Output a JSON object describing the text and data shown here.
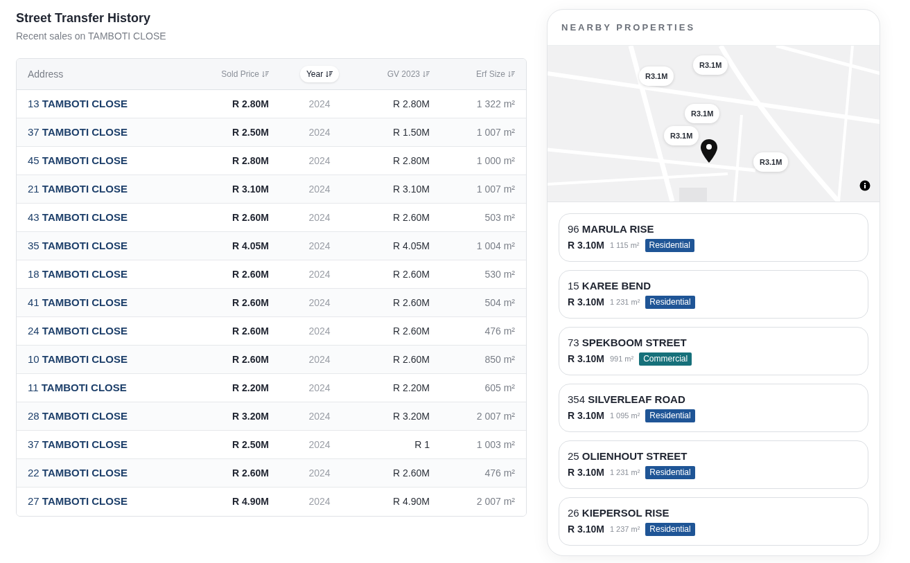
{
  "history": {
    "title": "Street Transfer History",
    "subtitle": "Recent sales on TAMBOTI CLOSE",
    "columns": [
      {
        "label": "Address",
        "sortable": false,
        "selected": false
      },
      {
        "label": "Sold Price",
        "sortable": true,
        "selected": false
      },
      {
        "label": "Year",
        "sortable": true,
        "selected": true
      },
      {
        "label": "GV 2023",
        "sortable": true,
        "selected": false
      },
      {
        "label": "Erf Size",
        "sortable": true,
        "selected": false
      }
    ],
    "rows": [
      {
        "address": "13 **TAMBOTI CLOSE**",
        "sold_price": "R 2.80M",
        "year": "2024",
        "gv_2023": "R 2.80M",
        "erf_size": "1 322 m²"
      },
      {
        "address": "37 **TAMBOTI CLOSE**",
        "sold_price": "R 2.50M",
        "year": "2024",
        "gv_2023": "R 1.50M",
        "erf_size": "1 007 m²"
      },
      {
        "address": "45 **TAMBOTI CLOSE**",
        "sold_price": "R 2.80M",
        "year": "2024",
        "gv_2023": "R 2.80M",
        "erf_size": "1 000 m²"
      },
      {
        "address": "21 **TAMBOTI CLOSE**",
        "sold_price": "R 3.10M",
        "year": "2024",
        "gv_2023": "R 3.10M",
        "erf_size": "1 007 m²"
      },
      {
        "address": "43 **TAMBOTI CLOSE**",
        "sold_price": "R 2.60M",
        "year": "2024",
        "gv_2023": "R 2.60M",
        "erf_size": "503 m²"
      },
      {
        "address": "35 **TAMBOTI CLOSE**",
        "sold_price": "R 4.05M",
        "year": "2024",
        "gv_2023": "R 4.05M",
        "erf_size": "1 004 m²"
      },
      {
        "address": "18 **TAMBOTI CLOSE**",
        "sold_price": "R 2.60M",
        "year": "2024",
        "gv_2023": "R 2.60M",
        "erf_size": "530 m²"
      },
      {
        "address": "41 **TAMBOTI CLOSE**",
        "sold_price": "R 2.60M",
        "year": "2024",
        "gv_2023": "R 2.60M",
        "erf_size": "504 m²"
      },
      {
        "address": "24 **TAMBOTI CLOSE**",
        "sold_price": "R 2.60M",
        "year": "2024",
        "gv_2023": "R 2.60M",
        "erf_size": "476 m²"
      },
      {
        "address": "10 **TAMBOTI CLOSE**",
        "sold_price": "R 2.60M",
        "year": "2024",
        "gv_2023": "R 2.60M",
        "erf_size": "850 m²"
      },
      {
        "address": "11 **TAMBOTI CLOSE**",
        "sold_price": "R 2.20M",
        "year": "2024",
        "gv_2023": "R 2.20M",
        "erf_size": "605 m²"
      },
      {
        "address": "28 **TAMBOTI CLOSE**",
        "sold_price": "R 3.20M",
        "year": "2024",
        "gv_2023": "R 3.20M",
        "erf_size": "2 007 m²"
      },
      {
        "address": "37 **TAMBOTI CLOSE**",
        "sold_price": "R 2.50M",
        "year": "2024",
        "gv_2023": "R 1",
        "erf_size": "1 003 m²"
      },
      {
        "address": "22 **TAMBOTI CLOSE**",
        "sold_price": "R 2.60M",
        "year": "2024",
        "gv_2023": "R 2.60M",
        "erf_size": "476 m²"
      },
      {
        "address": "27 **TAMBOTI CLOSE**",
        "sold_price": "R 4.90M",
        "year": "2024",
        "gv_2023": "R 4.90M",
        "erf_size": "2 007 m²"
      }
    ]
  },
  "nearby": {
    "title": "NEARBY PROPERTIES",
    "map": {
      "kind": "picture",
      "markers": [
        {
          "label": "R3.1M"
        },
        {
          "label": "R3.1M"
        },
        {
          "label": "R3.1M"
        },
        {
          "label": "R3.1M"
        },
        {
          "label": "R3.1M"
        }
      ]
    },
    "properties": [
      {
        "address": "96 **MARULA RISE**",
        "price": "R 3.10M",
        "size": "1 115 m²",
        "tag": "Residential",
        "color": "#1f5596"
      },
      {
        "address": "15 **KAREE BEND**",
        "price": "R 3.10M",
        "size": "1 231 m²",
        "tag": "Residential",
        "color": "#1f5596"
      },
      {
        "address": "73 **SPEKBOOM STREET**",
        "price": "R 3.10M",
        "size": "991 m²",
        "tag": "Commercial",
        "color": "#16707a"
      },
      {
        "address": "354 **SILVERLEAF ROAD**",
        "price": "R 3.10M",
        "size": "1 095 m²",
        "tag": "Residential",
        "color": "#1f5596"
      },
      {
        "address": "25 **OLIENHOUT STREET**",
        "price": "R 3.10M",
        "size": "1 231 m²",
        "tag": "Residential",
        "color": "#1f5596"
      },
      {
        "address": "26 **KIEPERSOL RISE**",
        "price": "R 3.10M",
        "size": "1 237 m²",
        "tag": "Residential",
        "color": "#1f5596"
      }
    ]
  }
}
